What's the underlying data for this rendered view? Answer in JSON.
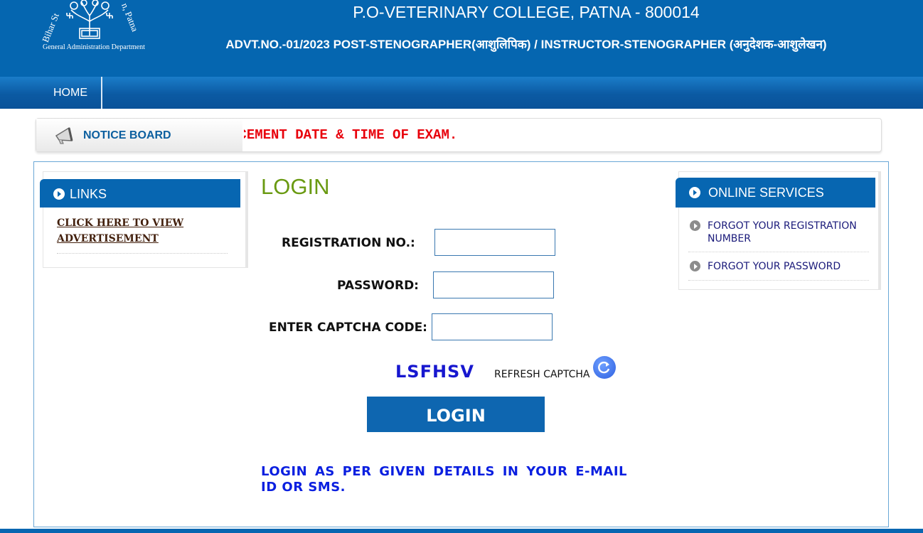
{
  "header": {
    "logo_text_left": "Bihar St",
    "logo_text_right": "n, Patna",
    "logo_dept": "General Administration Department",
    "college": "P.O-VETERINARY COLLEGE, PATNA - 800014",
    "advt": "ADVT.NO.-01/2023 POST-STENOGRAPHER(आशुलिपिक) / INSTRUCTOR-STENOGRAPHER (अनुदेशक-आशुलेखन)"
  },
  "nav": {
    "home": "HOME"
  },
  "notice": {
    "label": "NOTICE BOARD",
    "marquee": "ANNOUNCEMENT DATE & TIME OF EXAM."
  },
  "links": {
    "title": "LINKS",
    "items": [
      "CLICK HERE TO VIEW ADVERTISEMENT"
    ]
  },
  "login": {
    "title": "LOGIN",
    "registration_label": "REGISTRATION NO.:",
    "password_label": "PASSWORD:",
    "captcha_label": "ENTER CAPTCHA CODE:",
    "captcha_code": "LSFHSV",
    "refresh_label": "REFRESH CAPTCHA",
    "button": "LOGIN",
    "note": "LOGIN AS PER GIVEN DETAILS IN YOUR E-MAIL ID OR SMS."
  },
  "services": {
    "title": "ONLINE SERVICES",
    "items": [
      "FORGOT YOUR REGISTRATION NUMBER",
      "FORGOT YOUR PASSWORD"
    ]
  },
  "colors": {
    "header_bg": "#0566b0",
    "marquee": "#e8000b",
    "login_title": "#6a9a12",
    "captcha": "#1717cf",
    "note": "#0a1fe0"
  }
}
